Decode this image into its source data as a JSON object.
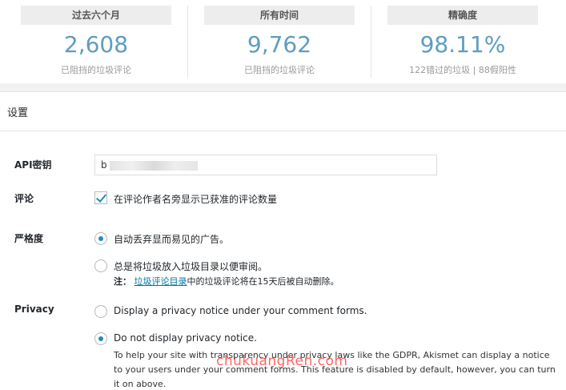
{
  "stats": [
    {
      "label": "过去六个月",
      "value": "2,608",
      "sub": "已阻挡的垃圾评论"
    },
    {
      "label": "所有时间",
      "value": "9,762",
      "sub": "已阻挡的垃圾评论"
    },
    {
      "label": "精确度",
      "value": "98.11%",
      "sub": "122错过的垃圾 | 88假阳性"
    }
  ],
  "settings": {
    "title": "设置",
    "api_key": {
      "label": "API密钥",
      "value": "b"
    },
    "comments": {
      "label": "评论",
      "checkbox_label": "在评论作者名旁显示已获准的评论数量"
    },
    "strictness": {
      "label": "严格度",
      "option1": "自动丢弃显而易见的广告。",
      "option2": "总是将垃圾放入垃圾目录以便审阅。",
      "note_prefix": "注：",
      "note_link": "垃圾评论目录",
      "note_suffix": "中的垃圾评论将在15天后被自动删除。"
    },
    "privacy": {
      "label": "Privacy",
      "option1": "Display a privacy notice under your comment forms.",
      "option2": "Do not display privacy notice.",
      "description": "To help your site with transparency under privacy laws like the GDPR, Akismet can display a notice to your users under your comment forms. This feature is disabled by default, however, you can turn it on above."
    }
  },
  "watermark": "chukuangRen.com",
  "colors": {
    "accent": "#5f9cbf",
    "link": "#0073aa",
    "watermark": "#ff5a5a"
  }
}
